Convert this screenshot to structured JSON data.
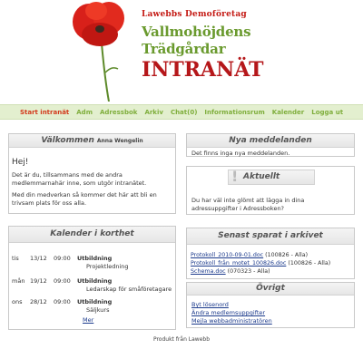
{
  "logo": {
    "line1": "Lawebbs Demoföretag",
    "line2": "Vallmohöjdens",
    "line3": "Trädgårdar",
    "line4": "INTRANÄT",
    "icon": "poppy-flower"
  },
  "nav": {
    "items": [
      {
        "label": "Start intranät",
        "active": true
      },
      {
        "label": "Adm"
      },
      {
        "label": "Adressbok"
      },
      {
        "label": "Arkiv"
      },
      {
        "label": "Chat(0)"
      },
      {
        "label": "Informationsrum"
      },
      {
        "label": "Kalender"
      },
      {
        "label": "Logga ut"
      }
    ]
  },
  "welcome": {
    "title": "Välkommen",
    "user": "Anna Wengelin",
    "greeting": "Hej!",
    "p1": "Det är du, tillsammans med de andra medlemmarnahär inne, som utgör intranätet.",
    "p2": "Med din medverkan så kommer det här att bli en trivsam plats för oss alla."
  },
  "calendar": {
    "title": "Kalender i korthet",
    "rows": [
      {
        "day": "tis",
        "date": "13/12",
        "time": "09:00",
        "event": "Utbildning",
        "desc": "Projektledning"
      },
      {
        "day": "mån",
        "date": "19/12",
        "time": "09:00",
        "event": "Utbildning",
        "desc": "Ledarskap för småföretagare"
      },
      {
        "day": "ons",
        "date": "28/12",
        "time": "09:00",
        "event": "Utbildning",
        "desc": "Säljkurs"
      }
    ],
    "more": "Mer"
  },
  "messages": {
    "title": "Nya meddelanden",
    "text": "Det finns inga nya meddelanden."
  },
  "aktuellt": {
    "title": "Aktuellt",
    "text": "Du har väl inte glömt att lägga in dina adressuppgifter i Adressboken?"
  },
  "saved": {
    "title": "Senast sparat i arkivet",
    "rows": [
      {
        "file": "Protokoll_2010-09-01.doc",
        "info": "(100826 - Alla)"
      },
      {
        "file": "Protokoll_från_motet_100826.doc",
        "info": "(100826 - Alla)"
      },
      {
        "file": "Schema.doc",
        "info": "(070323 - Alla)"
      }
    ]
  },
  "ovrigt": {
    "title": "Övrigt",
    "links": [
      "Byt lösenord",
      "Ändra medlemsuppgifter",
      "Mejla webbadministratören"
    ]
  },
  "footer": "Produkt från Lawebb",
  "colors": {
    "nav_bg": "#e3efcf",
    "nav_text": "#7fae3c",
    "nav_active": "#d33a1c",
    "logo_green": "#6a9a2e",
    "logo_red": "#b5171a",
    "link": "#1b3a8c"
  }
}
